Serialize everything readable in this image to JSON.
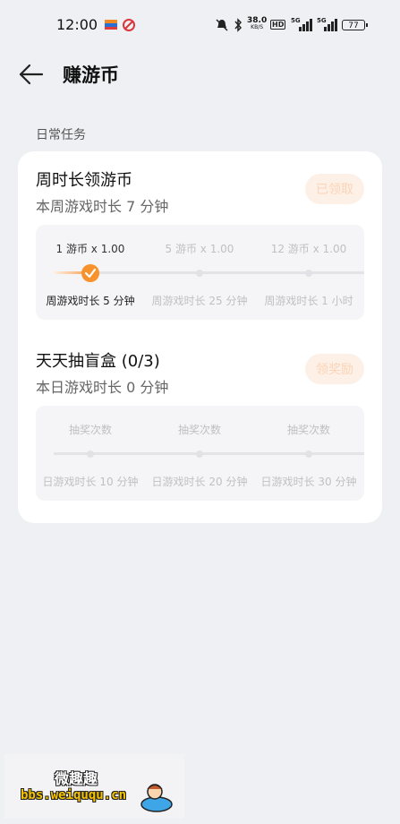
{
  "status_bar": {
    "time": "12:00",
    "net_speed": "38.0",
    "net_unit": "KB/S",
    "hd": "HD",
    "sig1": "5G",
    "sig2": "5G",
    "battery": "77"
  },
  "header": {
    "title": "赚游币"
  },
  "section_title": "日常任务",
  "task1": {
    "title": "周时长领游币",
    "subtitle": "本周游戏时长 7 分钟",
    "button": "已领取",
    "progress_fraction": 0.33,
    "milestones": [
      {
        "reward": "1 游币 x 1.00",
        "condition": "周游戏时长 5 分钟"
      },
      {
        "reward": "5 游币 x 1.00",
        "condition": "周游戏时长 25 分钟"
      },
      {
        "reward": "12 游币 x 1.00",
        "condition": "周游戏时长 1 小时"
      }
    ]
  },
  "task2": {
    "title": "天天抽盲盒 (0/3)",
    "subtitle": "本日游戏时长 0 分钟",
    "button": "领奖励",
    "milestones": [
      {
        "reward": "抽奖次数",
        "condition": "日游戏时长 10 分钟"
      },
      {
        "reward": "抽奖次数",
        "condition": "日游戏时长 20 分钟"
      },
      {
        "reward": "抽奖次数",
        "condition": "日游戏时长 30 分钟"
      }
    ]
  },
  "watermark": {
    "name": "微趣趣",
    "url": "bbs.weiququ.cn"
  }
}
